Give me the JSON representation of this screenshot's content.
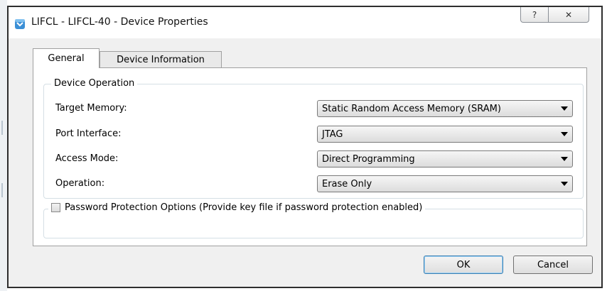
{
  "window": {
    "title": "LIFCL - LIFCL-40 - Device Properties",
    "help_glyph": "?",
    "close_glyph": "✕"
  },
  "tabs": [
    {
      "label": "General",
      "active": true
    },
    {
      "label": "Device Information",
      "active": false
    }
  ],
  "device_operation": {
    "legend": "Device Operation",
    "rows": [
      {
        "label": "Target Memory:",
        "value": "Static Random Access Memory (SRAM)"
      },
      {
        "label": "Port Interface:",
        "value": "JTAG"
      },
      {
        "label": "Access Mode:",
        "value": "Direct Programming"
      },
      {
        "label": "Operation:",
        "value": "Erase Only"
      }
    ]
  },
  "password": {
    "label": "Password Protection Options (Provide key file if password protection enabled)",
    "checked": false
  },
  "buttons": {
    "ok": "OK",
    "cancel": "Cancel"
  }
}
